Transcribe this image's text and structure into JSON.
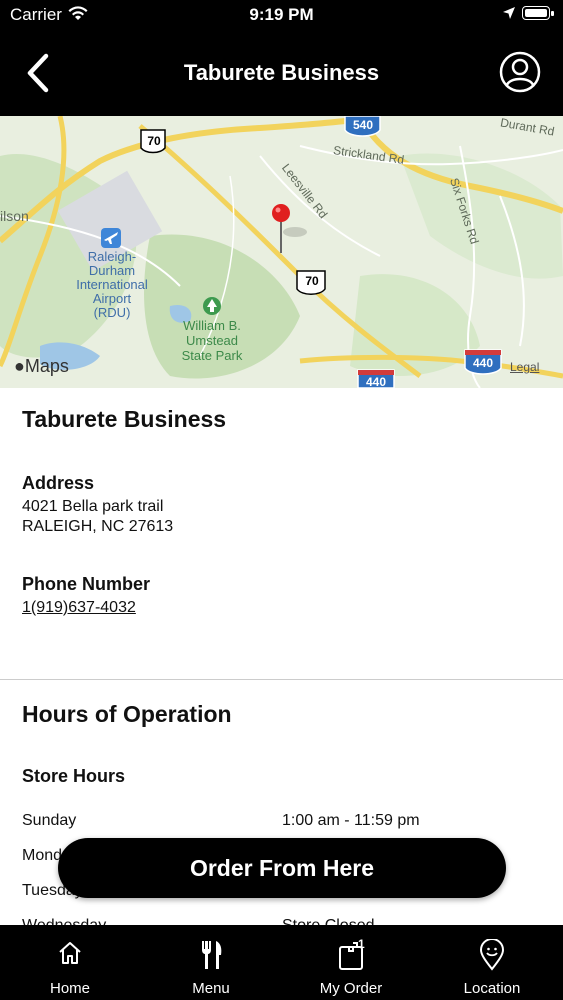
{
  "status_bar": {
    "carrier": "Carrier",
    "time": "9:19 PM"
  },
  "nav": {
    "title": "Taburete Business"
  },
  "map": {
    "labels": {
      "strickland": "Strickland Rd",
      "durant": "Durant Rd",
      "leesville": "Leesville Rd",
      "six_forks": "Six Forks Rd",
      "ilson": "ilson",
      "airport": "Raleigh-\nDurham\nInternational\nAirport\n(RDU)",
      "park": "William B.\nUmstead\nState Park",
      "shield_70_a": "70",
      "shield_70_b": "70",
      "shield_540": "540",
      "shield_440_a": "440",
      "shield_440_b": "440"
    },
    "brand": "Maps",
    "legal": "Legal"
  },
  "store": {
    "name": "Taburete Business",
    "address_label": "Address",
    "address_line1": "4021 Bella park trail",
    "address_line2": "RALEIGH, NC 27613",
    "phone_label": "Phone Number",
    "phone": "1(919)637-4032"
  },
  "hours": {
    "title": "Hours of Operation",
    "subtitle": "Store Hours",
    "rows": [
      {
        "day": "Sunday",
        "time": "1:00 am - 11:59 pm"
      },
      {
        "day": "Monday",
        "time": ""
      },
      {
        "day": "Tuesday",
        "time": ""
      },
      {
        "day": "Wednesday",
        "time": "Store Closed"
      }
    ]
  },
  "order_button": {
    "label": "Order From Here"
  },
  "tabs": [
    {
      "label": "Home",
      "icon": "home-icon"
    },
    {
      "label": "Menu",
      "icon": "fork-knife-icon"
    },
    {
      "label": "My Order",
      "icon": "bag-icon",
      "badge": "1"
    },
    {
      "label": "Location",
      "icon": "location-pin-icon"
    }
  ]
}
